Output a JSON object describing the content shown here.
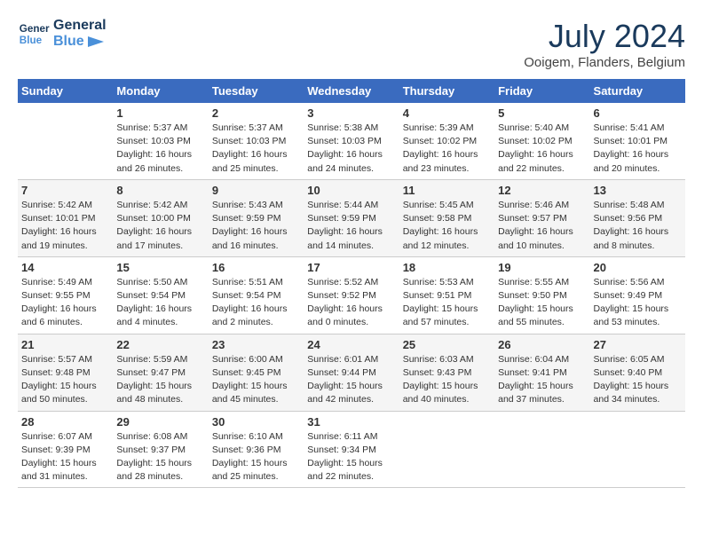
{
  "header": {
    "logo_line1": "General",
    "logo_line2": "Blue",
    "month_year": "July 2024",
    "location": "Ooigem, Flanders, Belgium"
  },
  "weekdays": [
    "Sunday",
    "Monday",
    "Tuesday",
    "Wednesday",
    "Thursday",
    "Friday",
    "Saturday"
  ],
  "weeks": [
    [
      {
        "day": "",
        "info": ""
      },
      {
        "day": "1",
        "info": "Sunrise: 5:37 AM\nSunset: 10:03 PM\nDaylight: 16 hours\nand 26 minutes."
      },
      {
        "day": "2",
        "info": "Sunrise: 5:37 AM\nSunset: 10:03 PM\nDaylight: 16 hours\nand 25 minutes."
      },
      {
        "day": "3",
        "info": "Sunrise: 5:38 AM\nSunset: 10:03 PM\nDaylight: 16 hours\nand 24 minutes."
      },
      {
        "day": "4",
        "info": "Sunrise: 5:39 AM\nSunset: 10:02 PM\nDaylight: 16 hours\nand 23 minutes."
      },
      {
        "day": "5",
        "info": "Sunrise: 5:40 AM\nSunset: 10:02 PM\nDaylight: 16 hours\nand 22 minutes."
      },
      {
        "day": "6",
        "info": "Sunrise: 5:41 AM\nSunset: 10:01 PM\nDaylight: 16 hours\nand 20 minutes."
      }
    ],
    [
      {
        "day": "7",
        "info": "Sunrise: 5:42 AM\nSunset: 10:01 PM\nDaylight: 16 hours\nand 19 minutes."
      },
      {
        "day": "8",
        "info": "Sunrise: 5:42 AM\nSunset: 10:00 PM\nDaylight: 16 hours\nand 17 minutes."
      },
      {
        "day": "9",
        "info": "Sunrise: 5:43 AM\nSunset: 9:59 PM\nDaylight: 16 hours\nand 16 minutes."
      },
      {
        "day": "10",
        "info": "Sunrise: 5:44 AM\nSunset: 9:59 PM\nDaylight: 16 hours\nand 14 minutes."
      },
      {
        "day": "11",
        "info": "Sunrise: 5:45 AM\nSunset: 9:58 PM\nDaylight: 16 hours\nand 12 minutes."
      },
      {
        "day": "12",
        "info": "Sunrise: 5:46 AM\nSunset: 9:57 PM\nDaylight: 16 hours\nand 10 minutes."
      },
      {
        "day": "13",
        "info": "Sunrise: 5:48 AM\nSunset: 9:56 PM\nDaylight: 16 hours\nand 8 minutes."
      }
    ],
    [
      {
        "day": "14",
        "info": "Sunrise: 5:49 AM\nSunset: 9:55 PM\nDaylight: 16 hours\nand 6 minutes."
      },
      {
        "day": "15",
        "info": "Sunrise: 5:50 AM\nSunset: 9:54 PM\nDaylight: 16 hours\nand 4 minutes."
      },
      {
        "day": "16",
        "info": "Sunrise: 5:51 AM\nSunset: 9:54 PM\nDaylight: 16 hours\nand 2 minutes."
      },
      {
        "day": "17",
        "info": "Sunrise: 5:52 AM\nSunset: 9:52 PM\nDaylight: 16 hours\nand 0 minutes."
      },
      {
        "day": "18",
        "info": "Sunrise: 5:53 AM\nSunset: 9:51 PM\nDaylight: 15 hours\nand 57 minutes."
      },
      {
        "day": "19",
        "info": "Sunrise: 5:55 AM\nSunset: 9:50 PM\nDaylight: 15 hours\nand 55 minutes."
      },
      {
        "day": "20",
        "info": "Sunrise: 5:56 AM\nSunset: 9:49 PM\nDaylight: 15 hours\nand 53 minutes."
      }
    ],
    [
      {
        "day": "21",
        "info": "Sunrise: 5:57 AM\nSunset: 9:48 PM\nDaylight: 15 hours\nand 50 minutes."
      },
      {
        "day": "22",
        "info": "Sunrise: 5:59 AM\nSunset: 9:47 PM\nDaylight: 15 hours\nand 48 minutes."
      },
      {
        "day": "23",
        "info": "Sunrise: 6:00 AM\nSunset: 9:45 PM\nDaylight: 15 hours\nand 45 minutes."
      },
      {
        "day": "24",
        "info": "Sunrise: 6:01 AM\nSunset: 9:44 PM\nDaylight: 15 hours\nand 42 minutes."
      },
      {
        "day": "25",
        "info": "Sunrise: 6:03 AM\nSunset: 9:43 PM\nDaylight: 15 hours\nand 40 minutes."
      },
      {
        "day": "26",
        "info": "Sunrise: 6:04 AM\nSunset: 9:41 PM\nDaylight: 15 hours\nand 37 minutes."
      },
      {
        "day": "27",
        "info": "Sunrise: 6:05 AM\nSunset: 9:40 PM\nDaylight: 15 hours\nand 34 minutes."
      }
    ],
    [
      {
        "day": "28",
        "info": "Sunrise: 6:07 AM\nSunset: 9:39 PM\nDaylight: 15 hours\nand 31 minutes."
      },
      {
        "day": "29",
        "info": "Sunrise: 6:08 AM\nSunset: 9:37 PM\nDaylight: 15 hours\nand 28 minutes."
      },
      {
        "day": "30",
        "info": "Sunrise: 6:10 AM\nSunset: 9:36 PM\nDaylight: 15 hours\nand 25 minutes."
      },
      {
        "day": "31",
        "info": "Sunrise: 6:11 AM\nSunset: 9:34 PM\nDaylight: 15 hours\nand 22 minutes."
      },
      {
        "day": "",
        "info": ""
      },
      {
        "day": "",
        "info": ""
      },
      {
        "day": "",
        "info": ""
      }
    ]
  ]
}
